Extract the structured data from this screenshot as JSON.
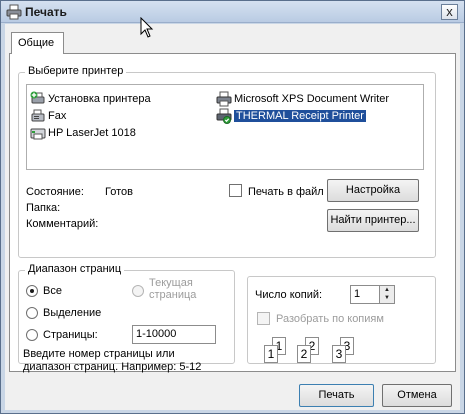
{
  "window": {
    "title": "Печать",
    "close_glyph": "x"
  },
  "tabs": [
    {
      "label": "Общие"
    }
  ],
  "select_printer": {
    "legend": "Выберите принтер",
    "printers": [
      {
        "name": "Установка принтера",
        "icon": "add-printer-icon"
      },
      {
        "name": "Fax",
        "icon": "fax-icon"
      },
      {
        "name": "HP LaserJet 1018",
        "icon": "printer-icon"
      },
      {
        "name": "Microsoft XPS Document Writer",
        "icon": "printer-icon"
      },
      {
        "name": "THERMAL Receipt Printer",
        "icon": "default-printer-icon",
        "selected": true
      }
    ],
    "status_label": "Состояние:",
    "status_value": "Готов",
    "location_label": "Папка:",
    "comment_label": "Комментарий:",
    "print_to_file_label": "Печать в файл",
    "print_to_file_checked": false,
    "preferences_button": "Настройка",
    "find_printer_button": "Найти принтер..."
  },
  "page_range": {
    "legend": "Диапазон страниц",
    "all_label": "Все",
    "current_page_label": "Текущая страница",
    "selection_label": "Выделение",
    "pages_label": "Страницы:",
    "pages_value": "1-10000",
    "selected": "all",
    "hint": "Введите номер страницы или диапазон страниц.  Например: 5-12"
  },
  "copies": {
    "label": "Число копий:",
    "value": "1",
    "collate_label": "Разобрать по копиям",
    "collate_checked": false,
    "collate_enabled": false,
    "illustration_numbers": [
      "1",
      "1",
      "2",
      "2",
      "3",
      "3"
    ]
  },
  "footer": {
    "print_button": "Печать",
    "cancel_button": "Отмена"
  },
  "colors": {
    "selection": "#1f4f9b",
    "window_frame": "#c9d6e6"
  }
}
